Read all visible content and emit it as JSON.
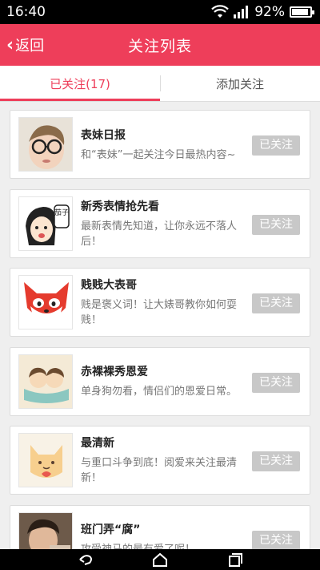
{
  "status_bar": {
    "time": "16:40",
    "battery": "92%"
  },
  "header": {
    "back_label": "返回",
    "title": "关注列表"
  },
  "tabs": [
    {
      "label": "已关注(17)",
      "active": true
    },
    {
      "label": "添加关注",
      "active": false
    }
  ],
  "follow_button_label": "已关注",
  "items": [
    {
      "name": "表妹日报",
      "desc": "和“表妹”一起关注今日最热内容~"
    },
    {
      "name": "新秀表情抢先看",
      "desc": "最新表情先知道，让你永远不落人后！"
    },
    {
      "name": "贱贱大表哥",
      "desc": "贱是褒义词！让大婊哥教你如何耍贱！"
    },
    {
      "name": "赤裸裸秀恩爱",
      "desc": "单身狗勿看，情侣们的恩爱日常。"
    },
    {
      "name": "最清新",
      "desc": "与重口斗争到底！阅爱来关注最清新！"
    },
    {
      "name": "班门弄“腐”",
      "desc": "攻受神马的最有爱了呢！"
    }
  ],
  "avatar_text": "茄子",
  "colors": {
    "accent": "#ee3e5a",
    "button_gray": "#c8c8c8"
  }
}
